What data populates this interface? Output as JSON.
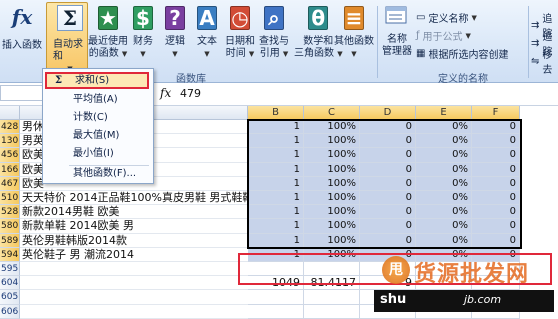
{
  "ribbon": {
    "insert_function": "插入函数",
    "autosum_line1": "自动求和",
    "recent_line1": "最近使用",
    "recent_line2": "的函数",
    "finance": "财务",
    "logic": "逻辑",
    "text": "文本",
    "datetime_line1": "日期和",
    "datetime_line2": "时间",
    "lookup_line1": "查找与",
    "lookup_line2": "引用",
    "math_line1": "数学和",
    "math_line2": "三角函数",
    "other": "其他函数",
    "library_group": "函数库",
    "name_manager_line1": "名称",
    "name_manager_line2": "管理器",
    "define_name": "定义名称",
    "use_in_formula": "用于公式",
    "create_from_selection": "根据所选内容创建",
    "defined_names_group": "定义的名称",
    "trace1": "追踪",
    "trace2": "追踪",
    "trace3": "移去"
  },
  "dropdown": {
    "items": [
      "求和(S)",
      "平均值(A)",
      "计数(C)",
      "最大值(M)",
      "最小值(I)",
      "其他函数(F)..."
    ]
  },
  "formula_bar": {
    "name_box": "B",
    "fx": "fx",
    "value": "479"
  },
  "columns": [
    "B",
    "C",
    "D",
    "E",
    "F"
  ],
  "rows": [
    {
      "num": "428",
      "a": "男休",
      "b": "1",
      "c": "100%",
      "d": "0",
      "e": "0%",
      "f": "0"
    },
    {
      "num": "130",
      "a": "男英",
      "b": "1",
      "c": "100%",
      "d": "0",
      "e": "0%",
      "f": "0"
    },
    {
      "num": "456",
      "a": "欧美",
      "b": "1",
      "c": "100%",
      "d": "0",
      "e": "0%",
      "f": "0"
    },
    {
      "num": "166",
      "a": "欧美",
      "b": "1",
      "c": "100%",
      "d": "0",
      "e": "0%",
      "f": "0"
    },
    {
      "num": "467",
      "a": "欧美",
      "b": "1",
      "c": "100%",
      "d": "0",
      "e": "0%",
      "f": "0"
    },
    {
      "num": "510",
      "a": "天天特价 2014正品鞋100%真皮男鞋 男式鞋靴",
      "b": "1",
      "c": "100%",
      "d": "0",
      "e": "0%",
      "f": "0"
    },
    {
      "num": "528",
      "a": "新款2014男鞋 欧美",
      "b": "1",
      "c": "100%",
      "d": "0",
      "e": "0%",
      "f": "0"
    },
    {
      "num": "580",
      "a": "新款单鞋 2014欧美 男",
      "b": "1",
      "c": "100%",
      "d": "0",
      "e": "0%",
      "f": "0"
    },
    {
      "num": "589",
      "a": "英伦男鞋韩版2014款",
      "b": "1",
      "c": "100%",
      "d": "0",
      "e": "0%",
      "f": "0"
    },
    {
      "num": "594",
      "a": "英伦鞋子 男 潮流2014",
      "b": "1",
      "c": "100%",
      "d": "0",
      "e": "0%",
      "f": "0"
    },
    {
      "num": "595",
      "a": "",
      "b": "",
      "c": "",
      "d": "",
      "e": "",
      "f": ""
    },
    {
      "num": "604",
      "a": "",
      "b": "1049",
      "c": "81.4117",
      "d": "9",
      "e": "",
      "f": ""
    },
    {
      "num": "605",
      "a": "",
      "b": "",
      "c": "",
      "d": "",
      "e": "",
      "f": ""
    },
    {
      "num": "606",
      "a": "",
      "b": "",
      "c": "",
      "d": "",
      "e": "",
      "f": ""
    }
  ],
  "watermark": {
    "logo": "甩",
    "chinese": "货源批发网",
    "english": "shu",
    "english2": "jb.com"
  }
}
